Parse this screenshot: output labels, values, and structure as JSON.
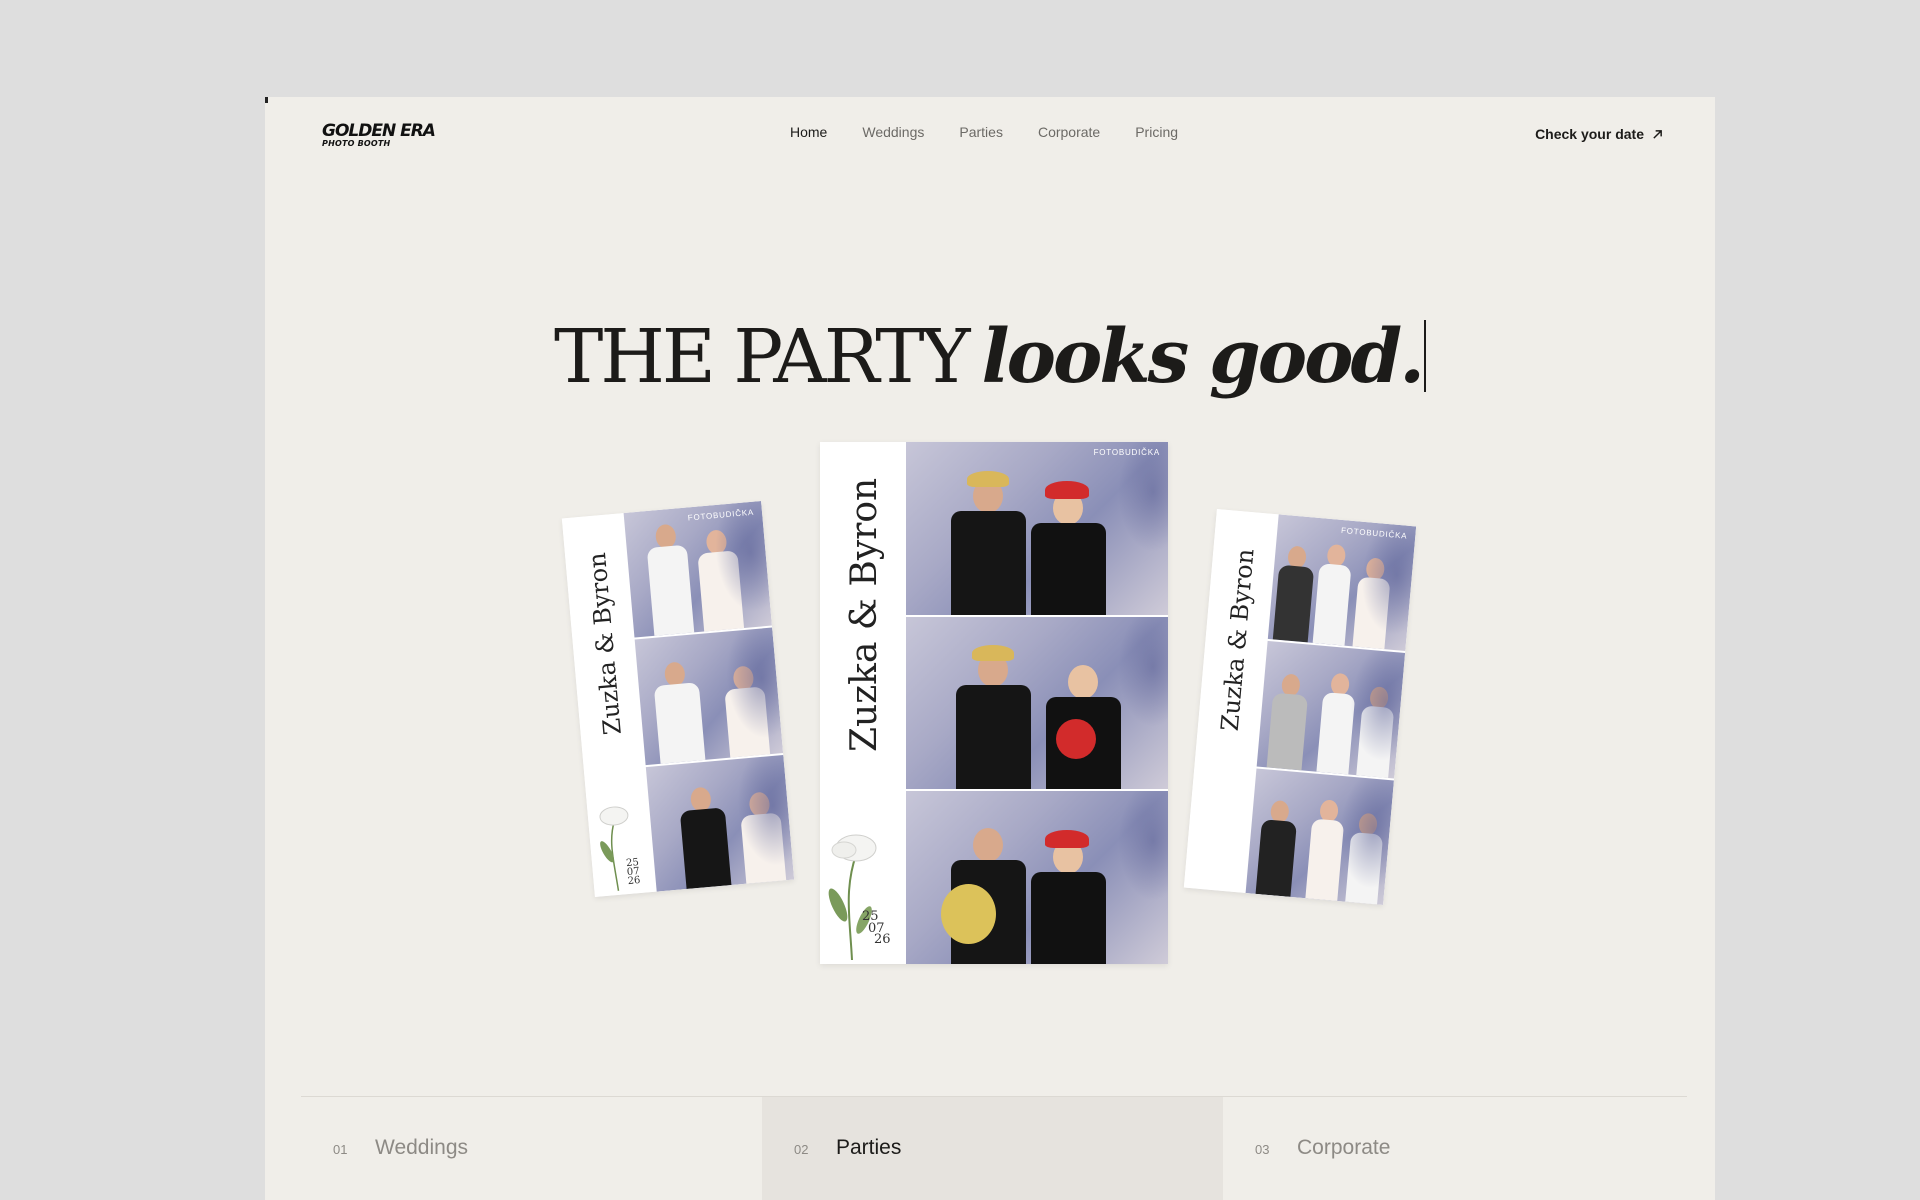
{
  "brand": {
    "name": "GOLDEN ERA",
    "tagline": "PHOTO BOOTH"
  },
  "nav": {
    "items": [
      {
        "label": "Home",
        "active": true
      },
      {
        "label": "Weddings",
        "active": false
      },
      {
        "label": "Parties",
        "active": false
      },
      {
        "label": "Corporate",
        "active": false
      },
      {
        "label": "Pricing",
        "active": false
      }
    ]
  },
  "cta": {
    "label": "Check your date",
    "icon": "arrow-up-right-icon"
  },
  "hero": {
    "headline_roman": "THE PARTY",
    "headline_italic": "looks good."
  },
  "strips": {
    "couple": "Zuzka & Byron",
    "date": [
      "25",
      "07",
      "26"
    ],
    "watermark": "FOTOBUDIČKA"
  },
  "tabs": [
    {
      "num": "01",
      "label": "Weddings",
      "active": false
    },
    {
      "num": "02",
      "label": "Parties",
      "active": true
    },
    {
      "num": "03",
      "label": "Corporate",
      "active": false
    }
  ],
  "colors": {
    "page_bg": "#dedede",
    "frame_bg": "#f0eee9",
    "active_tab_bg": "#e6e3de",
    "text_dark": "#1c1b19",
    "text_muted": "#8d8a85"
  }
}
